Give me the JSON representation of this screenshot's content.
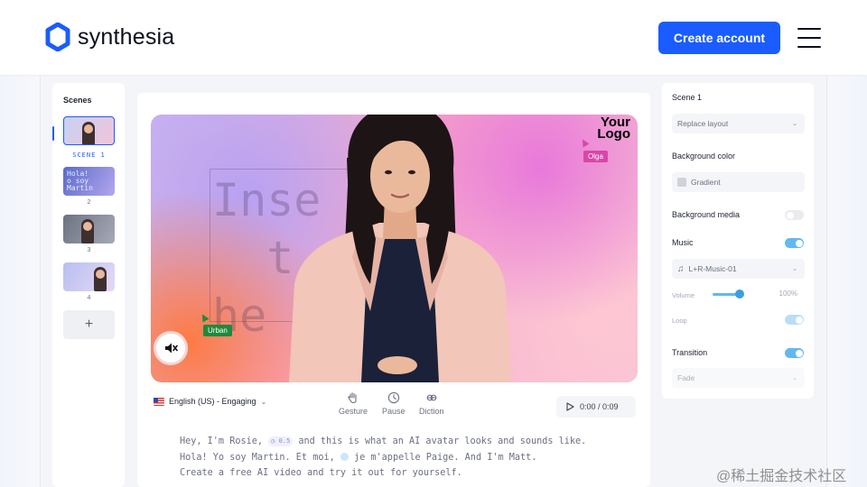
{
  "header": {
    "brand": "synthesia",
    "cta_label": "Create account"
  },
  "scenes_panel": {
    "title": "Scenes",
    "items": [
      {
        "label": "SCENE 1",
        "active": true,
        "thumb_text": ""
      },
      {
        "label": "2",
        "active": false,
        "thumb_text": "Hola!\no soy\nMartin"
      },
      {
        "label": "3",
        "active": false,
        "thumb_text": ""
      },
      {
        "label": "4",
        "active": false,
        "thumb_text": ""
      }
    ],
    "add_label": "+"
  },
  "canvas": {
    "placeholder_text": "Inse\n  t\nhe",
    "logo_line1": "Your",
    "logo_line2": "Logo",
    "collaborators": [
      {
        "name": "Olga",
        "color": "#d946a8"
      },
      {
        "name": "Urban",
        "color": "#1f8a3c"
      }
    ]
  },
  "toolbar": {
    "language": "English (US) - Engaging",
    "tools": [
      "Gesture",
      "Pause",
      "Diction"
    ],
    "time": "0:00 / 0:09"
  },
  "script": {
    "line1_a": "Hey, I'm Rosie, ",
    "pause_badge": "0.5",
    "line1_b": " and this is what an AI avatar looks and sounds like.",
    "line2_a": "Hola! Yo soy Martin. Et moi, ",
    "line2_b": " je m'appelle Paige. And I'm Matt.",
    "line3": "Create a free AI video and try it out for yourself."
  },
  "properties": {
    "scene_title": "Scene 1",
    "layout_select": "Replace layout",
    "background_color_label": "Background color",
    "background_color_value": "Gradient",
    "background_media_label": "Background media",
    "background_media_on": false,
    "music_label": "Music",
    "music_on": true,
    "music_track": "L+R-Music-01",
    "volume_label": "Volume",
    "volume_value": "100%",
    "loop_label": "Loop",
    "loop_on": true,
    "transition_label": "Transition",
    "transition_on": true,
    "transition_value": "Fade"
  },
  "colors": {
    "accent": "#1a5cff",
    "toggle_on": "#63b8ee"
  },
  "watermark": "@稀土掘金技术社区"
}
